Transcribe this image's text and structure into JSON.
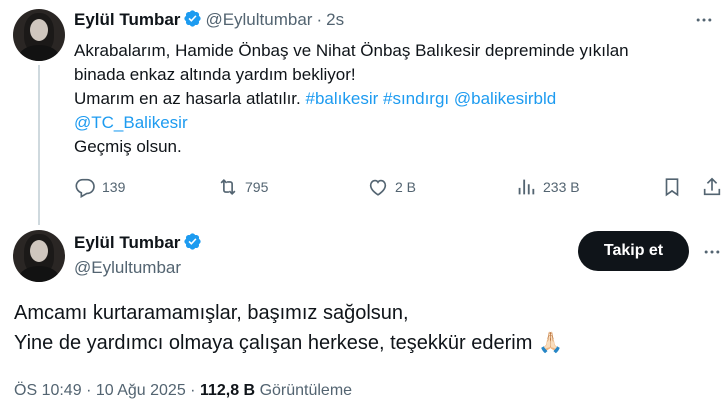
{
  "tweet1": {
    "author_name": "Eylül Tumbar",
    "handle": "@Eylultumbar",
    "separator": "·",
    "time": "2s",
    "text_line1": "Akrabalarım, Hamide Önbaş ve Nihat Önbaş Balıkesir depreminde yıkılan",
    "text_line2": "binada enkaz altında yardım bekliyor!",
    "text_line3_prefix": "Umarım en az hasarla atlatılır.",
    "hashtag1": "#balıkesir",
    "hashtag2": "#sındırgı",
    "mention1": "@balikesirbld",
    "mention2": "@TC_Balikesir",
    "text_line5": "Geçmiş olsun.",
    "replies": "139",
    "reposts": "795",
    "likes": "2 B",
    "views": "233 B"
  },
  "tweet2": {
    "author_name": "Eylül Tumbar",
    "handle": "@Eylultumbar",
    "follow_label": "Takip et",
    "text_line1": "Amcamı kurtaramamışlar, başımız sağolsun,",
    "text_line2": "Yine de yardımcı olmaya çalışan herkese, teşekkür ederim",
    "emoji": "🙏🏻",
    "time": "ÖS 10:49",
    "dot": "·",
    "date": "10 Ağu 2025",
    "views_count": "112,8 B",
    "views_label": "Görüntüleme"
  },
  "colors": {
    "link": "#1d9bf0",
    "muted": "#536471",
    "text": "#0f1419",
    "verified": "#1d9bf0"
  },
  "icons": {
    "verified": "verified-badge-icon",
    "more": "more-horizontal-icon",
    "reply": "reply-icon",
    "repost": "repost-icon",
    "like": "heart-icon",
    "views": "views-chart-icon",
    "bookmark": "bookmark-icon",
    "share": "share-icon"
  }
}
